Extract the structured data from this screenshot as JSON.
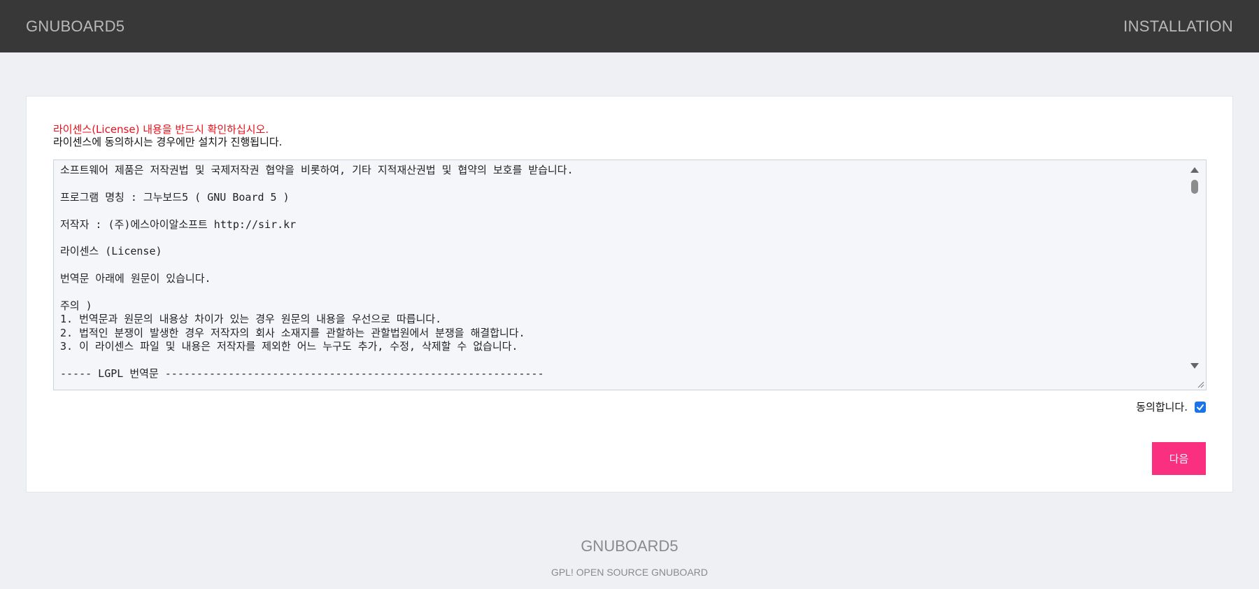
{
  "header": {
    "brand": "GNUBOARD5",
    "section": "INSTALLATION"
  },
  "notice": {
    "warning": "라이센스(License) 내용을 반드시 확인하십시오.",
    "subtext": "라이센스에 동의하시는 경우에만 설치가 진행됩니다."
  },
  "license": {
    "text": "소프트웨어 제품은 저작권법 및 국제저작권 협약을 비롯하여, 기타 지적재산권법 및 협약의 보호를 받습니다.\n\n프로그램 명칭 : 그누보드5 ( GNU Board 5 )\n\n저작자 : (주)에스아이알소프트 http://sir.kr\n\n라이센스 (License)\n\n번역문 아래에 원문이 있습니다.\n\n주의 )\n1. 번역문과 원문의 내용상 차이가 있는 경우 원문의 내용을 우선으로 따릅니다.\n2. 법적인 분쟁이 발생한 경우 저작자의 회사 소재지를 관할하는 관할법원에서 분쟁을 해결합니다.\n3. 이 라이센스 파일 및 내용은 저작자를 제외한 어느 누구도 추가, 수정, 삭제할 수 없습니다.\n\n----- LGPL 번역문 ------------------------------------------------------------"
  },
  "agree": {
    "label": "동의합니다.",
    "checked": true
  },
  "actions": {
    "next_label": "다음"
  },
  "footer": {
    "brand": "GNUBOARD5",
    "tagline": "GPL! OPEN SOURCE GNUBOARD"
  },
  "colors": {
    "header_bg": "#383838",
    "accent": "#fb2f7f",
    "warning": "#e8101a",
    "checkbox": "#1a73e8"
  }
}
